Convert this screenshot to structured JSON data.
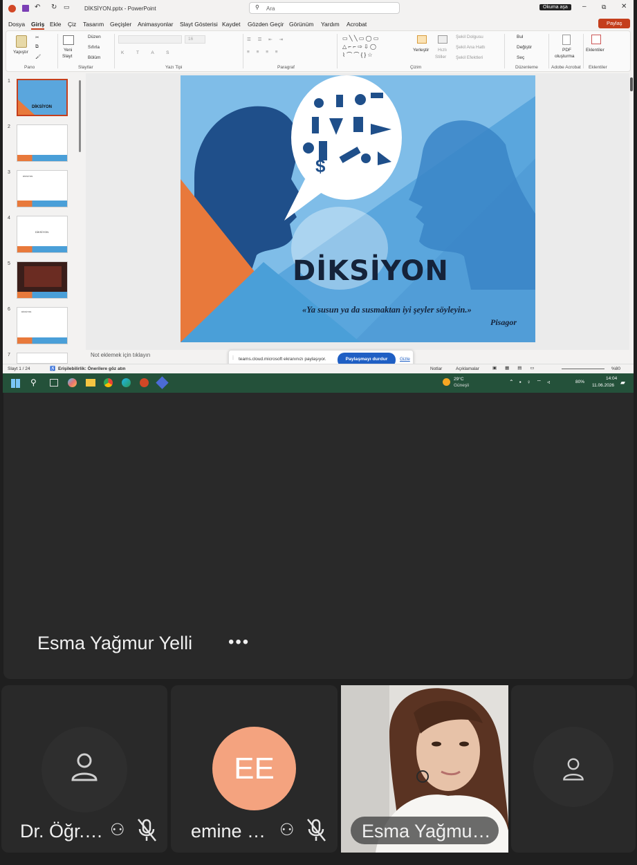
{
  "powerpoint": {
    "file_title": "DİKSİYON.pptx  -  PowerPoint",
    "search_placeholder": "Ara",
    "reading_mode_button": "Okuma aşa",
    "share_button": "Paylaş",
    "menu": [
      "Dosya",
      "Giriş",
      "Ekle",
      "Çiz",
      "Tasarım",
      "Geçişler",
      "Animasyonlar",
      "Slayt Gösterisi",
      "Kaydet",
      "Gözden Geçir",
      "Görünüm",
      "Yardım",
      "Acrobat"
    ],
    "active_tab": "Giriş",
    "ribbon": {
      "paste": "Yapıştır",
      "new_slide_1": "Yeni",
      "new_slide_2": "Slayt",
      "layout": "Düzen",
      "reset": "Sıfırla",
      "section": "Bölüm",
      "font_size": "16",
      "arrange": "Yerleştir",
      "quick_styles_1": "Hızlı",
      "quick_styles_2": "Stiller",
      "shape_fill": "Şekil Dolgusu",
      "shape_outline": "Şekil Ana Hattı",
      "shape_effects": "Şekil Efektleri",
      "find": "Bul",
      "replace": "Değiştir",
      "select": "Seç",
      "pdf_1": "PDF",
      "pdf_2": "oluşturma",
      "addins": "Eklentiler",
      "groups": [
        "Pano",
        "Slaytlar",
        "Yazı Tipi",
        "Paragraf",
        "Çizim",
        "Düzenleme",
        "Adobe Acrobat",
        "Eklentiler"
      ]
    },
    "slide": {
      "title": "DİKSİYON",
      "quote": "«Ya susun ya da susmaktan iyi şeyler söyleyin.»",
      "author": "Pisagor"
    },
    "thumbnails": [
      {
        "num": "1",
        "title": "DİKSİYON"
      },
      {
        "num": "2",
        "title": ""
      },
      {
        "num": "3",
        "title": "DİKSİYON"
      },
      {
        "num": "4",
        "title": "DİKSİYON"
      },
      {
        "num": "5",
        "title": ""
      },
      {
        "num": "6",
        "title": "DİKSİYON"
      },
      {
        "num": "7",
        "title": ""
      }
    ],
    "notes_placeholder": "Not eklemek için tıklayın",
    "status": {
      "slide_counter": "Slayt 1 / 24",
      "accessibility": "Erişilebilirlik: Önerilere göz atın",
      "notes": "Notlar",
      "comments": "Açıklamalar",
      "zoom": "%80"
    },
    "share_notice": {
      "text": "teams.cloud.microsoft ekranınızı paylaşıyor.",
      "stop_button": "Paylaşmayı durdur",
      "hide": "Gizle"
    },
    "taskbar": {
      "weather_temp": "29°C",
      "weather_desc": "Güneşli",
      "battery": "80%",
      "time": "14:04",
      "date": "11.06.2026"
    }
  },
  "call": {
    "presenter_name": "Esma Yağmur Yelli",
    "more_label": "•••",
    "participants": [
      {
        "name": "Dr. Öğr.…",
        "initials": ""
      },
      {
        "name": "emine …",
        "initials": "EE"
      },
      {
        "name": "Esma Yağmu…",
        "initials": ""
      }
    ]
  },
  "colors": {
    "taskbar": "#24513a",
    "slide_blue": "#5aa6dd",
    "slide_dark_blue": "#1f4f8a",
    "slide_orange": "#e8793b",
    "avatar_peach": "#f4a37f",
    "share_stop_button": "#1f5fc4"
  }
}
